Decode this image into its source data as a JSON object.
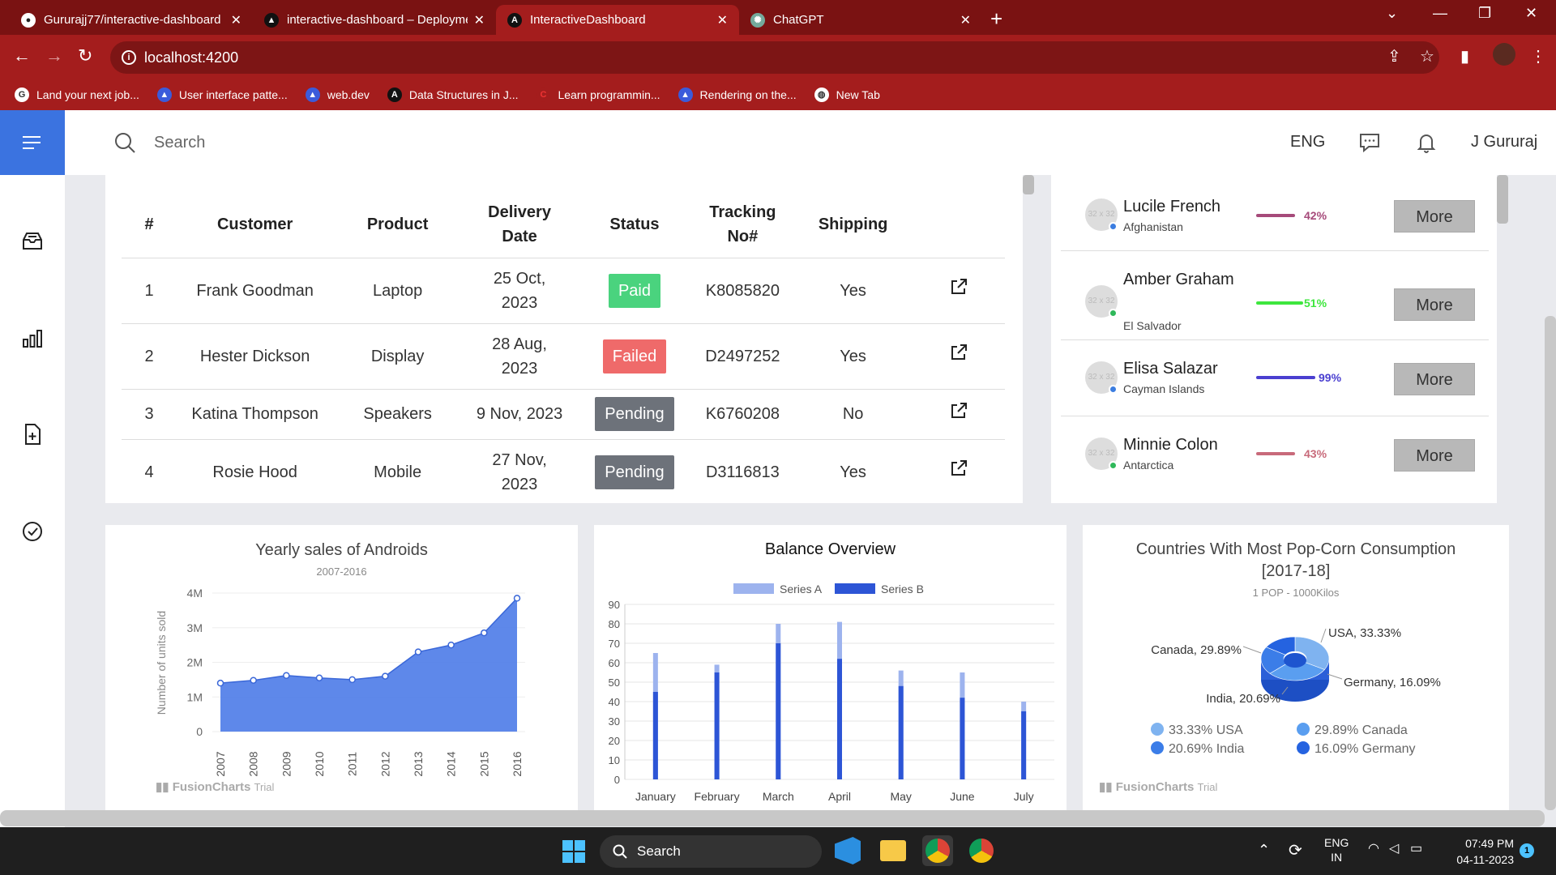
{
  "browser": {
    "tabs": [
      {
        "title": "Gururajj77/interactive-dashboard",
        "icon": "github-icon"
      },
      {
        "title": "interactive-dashboard – Deployme",
        "icon": "vercel-icon"
      },
      {
        "title": "InteractiveDashboard",
        "icon": "angular-icon"
      },
      {
        "title": "ChatGPT",
        "icon": "chatgpt-icon"
      }
    ],
    "url": "localhost:4200",
    "bookmarks": [
      {
        "label": "Land your next job...",
        "icon": "google-icon"
      },
      {
        "label": "User interface patte...",
        "icon": "bookmark-icon"
      },
      {
        "label": "web.dev",
        "icon": "bookmark-icon"
      },
      {
        "label": "Data Structures in J...",
        "icon": "angular-icon"
      },
      {
        "label": "Learn programmin...",
        "icon": "codecademy-icon"
      },
      {
        "label": "Rendering on the...",
        "icon": "bookmark-icon"
      },
      {
        "label": "New Tab",
        "icon": "globe-icon"
      }
    ]
  },
  "header": {
    "search_placeholder": "Search",
    "language": "ENG",
    "user_name": "J Gururaj"
  },
  "orders": {
    "columns": [
      "#",
      "Customer",
      "Product",
      "Delivery Date",
      "Status",
      "Tracking No#",
      "Shipping"
    ],
    "rows": [
      {
        "num": "1",
        "customer": "Frank Goodman",
        "product": "Laptop",
        "date": "25 Oct, 2023",
        "status": "Paid",
        "status_color": "#4ad37e",
        "tracking": "K8085820",
        "shipping": "Yes"
      },
      {
        "num": "2",
        "customer": "Hester Dickson",
        "product": "Display",
        "date": "28 Aug, 2023",
        "status": "Failed",
        "status_color": "#ef6a6a",
        "tracking": "D2497252",
        "shipping": "Yes"
      },
      {
        "num": "3",
        "customer": "Katina Thompson",
        "product": "Speakers",
        "date": "9 Nov, 2023",
        "status": "Pending",
        "status_color": "#6d727a",
        "tracking": "K6760208",
        "shipping": "No"
      },
      {
        "num": "4",
        "customer": "Rosie Hood",
        "product": "Mobile",
        "date": "27 Nov, 2023",
        "status": "Pending",
        "status_color": "#6d727a",
        "tracking": "D3116813",
        "shipping": "Yes"
      }
    ]
  },
  "people": [
    {
      "name": "Lucile French",
      "country": "Afghanistan",
      "percent": "42%",
      "color": "#a64a7a",
      "dot": "#3b7de0",
      "avatar_text": "32 x 32",
      "more": "More"
    },
    {
      "name": "Amber Graham",
      "country": "El Salvador",
      "percent": "51%",
      "color": "#3ee63e",
      "dot": "#2fb85a",
      "avatar_text": "32 x 32",
      "more": "More"
    },
    {
      "name": "Elisa Salazar",
      "country": "Cayman Islands",
      "percent": "99%",
      "color": "#4a3fd0",
      "dot": "#3b7de0",
      "avatar_text": "32 x 32",
      "more": "More"
    },
    {
      "name": "Minnie Colon",
      "country": "Antarctica",
      "percent": "43%",
      "color": "#c86a7a",
      "dot": "#2fb85a",
      "avatar_text": "32 x 32",
      "more": "More"
    }
  ],
  "chart_data": [
    {
      "type": "area",
      "title": "Yearly sales of Androids",
      "subtitle": "2007-2016",
      "ylabel": "Number of units sold",
      "categories": [
        "2007",
        "2008",
        "2009",
        "2010",
        "2011",
        "2012",
        "2013",
        "2014",
        "2015",
        "2016"
      ],
      "values": [
        1.4,
        1.48,
        1.62,
        1.55,
        1.5,
        1.6,
        2.3,
        2.5,
        2.85,
        3.85
      ],
      "y_ticks": [
        "0",
        "1M",
        "2M",
        "3M",
        "4M"
      ],
      "ylim": [
        0,
        4
      ],
      "color": "#4d7be8",
      "credit": "FusionCharts",
      "credit_suffix": "Trial"
    },
    {
      "type": "bar",
      "title": "Balance Overview",
      "categories": [
        "January",
        "February",
        "March",
        "April",
        "May",
        "June",
        "July"
      ],
      "series": [
        {
          "name": "Series A",
          "values": [
            65,
            59,
            80,
            81,
            56,
            55,
            40
          ],
          "color": "#9db3ee"
        },
        {
          "name": "Series B",
          "values": [
            45,
            55,
            70,
            62,
            48,
            42,
            35
          ],
          "color": "#2d55d6"
        }
      ],
      "y_ticks": [
        "0",
        "10",
        "20",
        "30",
        "40",
        "50",
        "60",
        "70",
        "80",
        "90"
      ],
      "ylim": [
        0,
        90
      ]
    },
    {
      "type": "pie",
      "title": "Countries With Most Pop-Corn Consumption",
      "title_line2": "[2017-18]",
      "subtitle": "1 POP - 1000Kilos",
      "slices": [
        {
          "label": "USA",
          "value": 33.33,
          "callout": "USA, 33.33%",
          "legend": "33.33% USA",
          "color": "#7fb3f0"
        },
        {
          "label": "Canada",
          "value": 29.89,
          "callout": "Canada, 29.89%",
          "legend": "29.89% Canada",
          "color": "#5a9ef0"
        },
        {
          "label": "India",
          "value": 20.69,
          "callout": "India, 20.69%",
          "legend": "20.69% India",
          "color": "#3b7de8"
        },
        {
          "label": "Germany",
          "value": 16.09,
          "callout": "Germany, 16.09%",
          "legend": "16.09% Germany",
          "color": "#2563e0"
        }
      ],
      "credit": "FusionCharts",
      "credit_suffix": "Trial"
    }
  ],
  "taskbar": {
    "search": "Search",
    "lang_top": "ENG",
    "lang_bottom": "IN",
    "time": "07:49 PM",
    "date": "04-11-2023",
    "notifications": "1"
  }
}
